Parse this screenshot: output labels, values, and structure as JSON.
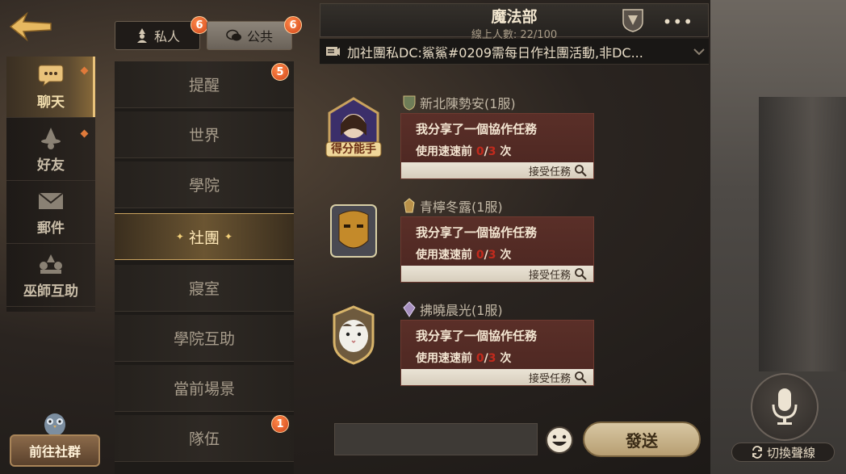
{
  "left_nav": {
    "items": [
      {
        "label": "聊天",
        "icon": "chat-bubble-icon",
        "active": true,
        "has_dot": true
      },
      {
        "label": "好友",
        "icon": "wizard-hat-icon",
        "active": false,
        "has_dot": true
      },
      {
        "label": "郵件",
        "icon": "envelope-icon",
        "active": false,
        "has_dot": false
      },
      {
        "label": "巫師互助",
        "icon": "mutual-aid-icon",
        "active": false,
        "has_dot": false
      }
    ],
    "social_button": "前往社群"
  },
  "tabs": {
    "private_label": "私人",
    "private_badge": "6",
    "public_label": "公共",
    "public_badge": "6"
  },
  "channels": [
    {
      "label": "提醒",
      "badge": "5"
    },
    {
      "label": "世界",
      "badge": null
    },
    {
      "label": "學院",
      "badge": null
    },
    {
      "label": "社團",
      "badge": null,
      "active": true
    },
    {
      "label": "寢室",
      "badge": null
    },
    {
      "label": "學院互助",
      "badge": null
    },
    {
      "label": "當前場景",
      "badge": null
    },
    {
      "label": "隊伍",
      "badge": "1"
    }
  ],
  "chat": {
    "title": "魔法部",
    "online": "線上人數: 22/100",
    "announcement": "加社團私DC:鯊鯊#0209需每日作社團活動,非DC..."
  },
  "messages": [
    {
      "sender": "新北陳勢安(1服)",
      "avatar_caption": "得分能手",
      "line1": "我分享了一個協作任務",
      "line2_prefix": "使用速速前 ",
      "progress_done": "0",
      "progress_sep": "/",
      "progress_total": "3",
      "line2_suffix": " 次",
      "accept": "接受任務"
    },
    {
      "sender": "青檸冬露(1服)",
      "avatar_caption": "",
      "line1": "我分享了一個協作任務",
      "line2_prefix": "使用速速前 ",
      "progress_done": "0",
      "progress_sep": "/",
      "progress_total": "3",
      "line2_suffix": " 次",
      "accept": "接受任務"
    },
    {
      "sender": "拂曉晨光(1服)",
      "avatar_caption": "",
      "line1": "我分享了一個協作任務",
      "line2_prefix": "使用速速前 ",
      "progress_done": "0",
      "progress_sep": "/",
      "progress_total": "3",
      "line2_suffix": " 次",
      "accept": "接受任務"
    }
  ],
  "composer": {
    "send_label": "發送",
    "switch_voice_label": "切換聲線"
  },
  "colors": {
    "accent_gold": "#e9c27a",
    "bubble": "#5a2f28",
    "badge_orange": "#d1451a",
    "progress_red": "#c22a1d"
  }
}
